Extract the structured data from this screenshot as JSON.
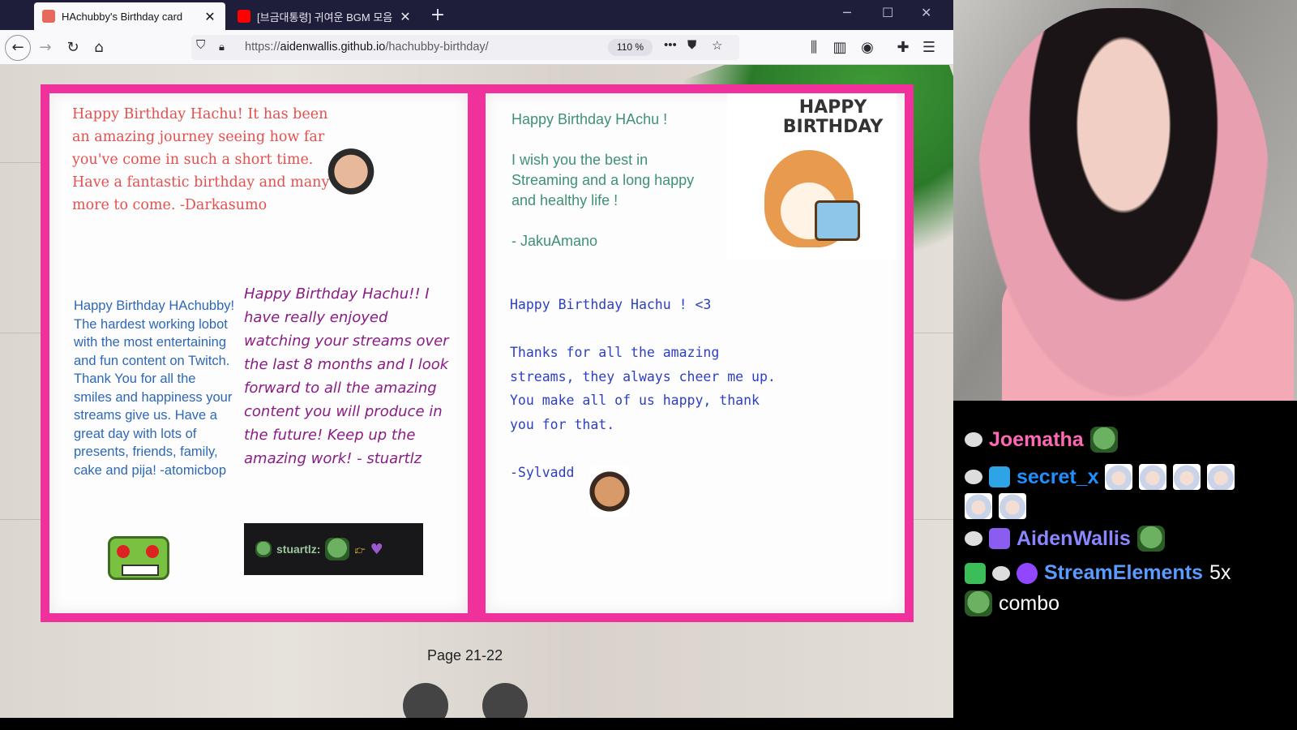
{
  "browser": {
    "tabs": [
      {
        "title": "HAchubby's Birthday card",
        "active": true
      },
      {
        "title": "[브금대통령] 귀여운 BGM 모음",
        "active": false
      }
    ],
    "url_prefix": "https://",
    "url_domain": "aidenwallis.github.io",
    "url_path": "/hachubby-birthday/",
    "zoom": "110 %"
  },
  "card": {
    "page_label": "Page 21-22",
    "left": {
      "msg_darkasumo": "Happy Birthday Hachu! It has been an amazing journey seeing how far you've come in such a short time. Have a fantastic birthday and many more to come. -Darkasumo",
      "msg_atomicbop": "Happy Birthday HAchubby! The hardest working lobot with the most entertaining and fun content on Twitch. Thank You for all the smiles and happiness your streams give us. Have a great day with lots of presents, friends, family, cake and pija! -atomicbop",
      "msg_stuartlz": "Happy Birthday Hachu!! I have really enjoyed watching your streams over the last 8 months and I look forward to all the amazing content you will produce in the future! Keep up the amazing work! - stuartlz",
      "chat_username": "stuartlz:"
    },
    "right": {
      "msg_jaku": "Happy Birthday HAchu !\n\nI wish you the best in Streaming and a long happy and healthy life !\n\n- JakuAmano",
      "sticker_text": "HAPPY BIRTHDAY",
      "msg_sylvadd": "Happy Birthday Hachu ! <3\n\nThanks for all the amazing streams, they always cheer me up.\nYou make all of us happy, thank you for that.\n\n-Sylvadd"
    }
  },
  "chat": {
    "messages": [
      {
        "user": "Joematha",
        "color": "#ff69b4"
      },
      {
        "user": "secret_x",
        "color": "#1e90ff"
      },
      {
        "user": "AidenWallis",
        "color": "#8a86ff"
      },
      {
        "user": "StreamElements",
        "color": "#5b9bff",
        "text": "5x"
      },
      {
        "text": "combo"
      }
    ]
  },
  "colors": {
    "accent": "#f0319b",
    "tab_bar": "#1f1e3a"
  }
}
